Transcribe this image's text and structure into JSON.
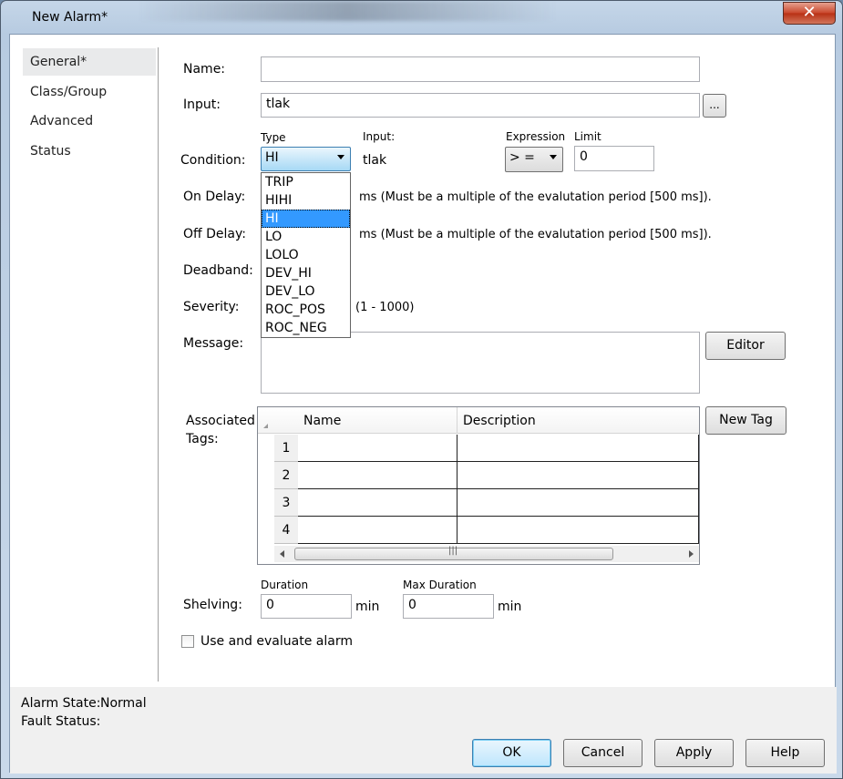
{
  "window": {
    "title": "New Alarm*",
    "close_glyph": "✕"
  },
  "nav": {
    "items": [
      "General*",
      "Class/Group",
      "Advanced",
      "Status"
    ]
  },
  "form": {
    "name_label": "Name:",
    "name_value": "",
    "input_label": "Input:",
    "input_value": "tlak",
    "browse_label": "...",
    "condition_label": "Condition:",
    "type_header": "Type",
    "type_value": "HI",
    "type_options": [
      "TRIP",
      "HIHI",
      "HI",
      "LO",
      "LOLO",
      "DEV_HI",
      "DEV_LO",
      "ROC_POS",
      "ROC_NEG"
    ],
    "input_header": "Input:",
    "input_display": "tlak",
    "expression_header": "Expression",
    "expression_value": "> =",
    "limit_header": "Limit",
    "limit_value": "0",
    "on_delay_label": "On Delay:",
    "on_delay_hint": "ms (Must be a multiple of the evalutation period [500 ms]).",
    "off_delay_label": "Off Delay:",
    "off_delay_hint": "ms (Must be a multiple of the evalutation period [500 ms]).",
    "deadband_label": "Deadband:",
    "severity_label": "Severity:",
    "severity_hint": "(1 - 1000)",
    "message_label": "Message:",
    "editor_button": "Editor",
    "assoc_label_1": "Associated",
    "assoc_label_2": "Tags:",
    "new_tag_button": "New Tag",
    "shelving_label": "Shelving:",
    "duration_header": "Duration",
    "duration_value": "0",
    "duration_unit": "min",
    "max_duration_header": "Max Duration",
    "max_duration_value": "0",
    "max_duration_unit": "min",
    "use_checkbox_label": "Use and evaluate alarm"
  },
  "grid": {
    "columns": [
      "Name",
      "Description"
    ],
    "rows": [
      "1",
      "2",
      "3",
      "4"
    ],
    "scroll_thumb_glyph": "|||"
  },
  "status": {
    "alarm_state_label": "Alarm State:",
    "alarm_state_value": "Normal",
    "fault_status_label": "Fault Status:"
  },
  "buttons": {
    "ok": "OK",
    "cancel": "Cancel",
    "apply": "Apply",
    "help": "Help"
  }
}
